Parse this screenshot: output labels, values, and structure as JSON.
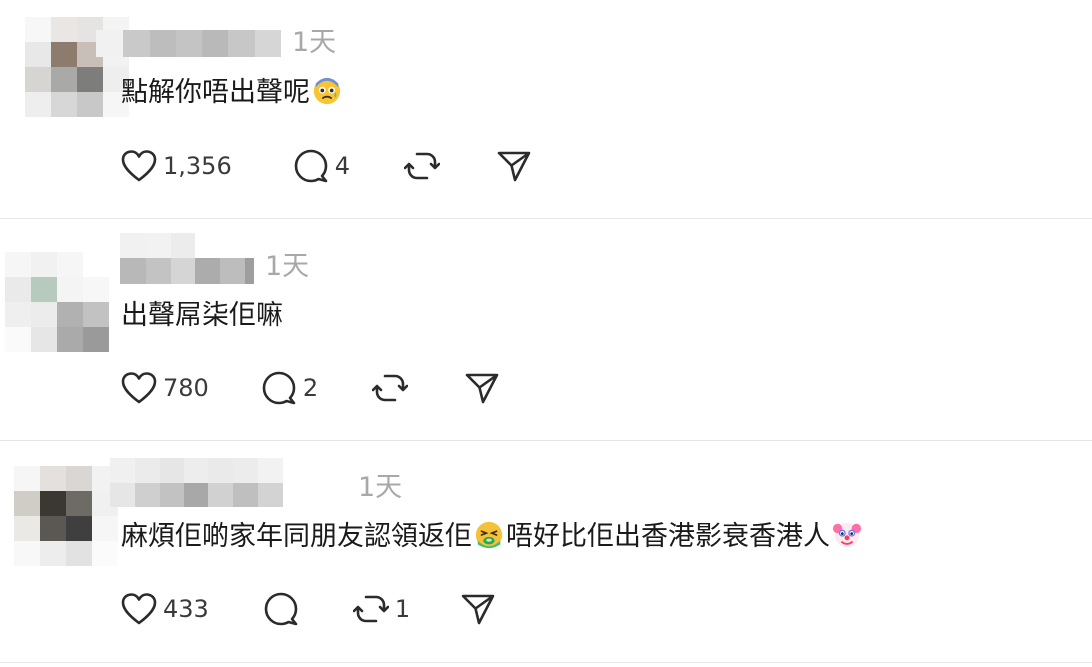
{
  "posts": [
    {
      "time": "1天",
      "text": "點解你唔出聲呢",
      "emojis": [
        "anxious-face-emoji"
      ],
      "likes": "1,356",
      "replies": "4",
      "reposts": ""
    },
    {
      "time": "1天",
      "text": "出聲屌柒佢嘛",
      "emojis": [],
      "likes": "780",
      "replies": "2",
      "reposts": ""
    },
    {
      "time": "1天",
      "text_part1": "麻煩佢啲家年同朋友認領返佢",
      "text_part2": "唔好比佢出香港影衰香港人",
      "emojis": [
        "nauseated-face-emoji",
        "clown-face-emoji"
      ],
      "likes": "433",
      "replies": "",
      "reposts": "1"
    }
  ],
  "icons": {
    "like": "heart-icon",
    "reply": "comment-bubble-icon",
    "repost": "repost-icon",
    "share": "send-icon"
  }
}
